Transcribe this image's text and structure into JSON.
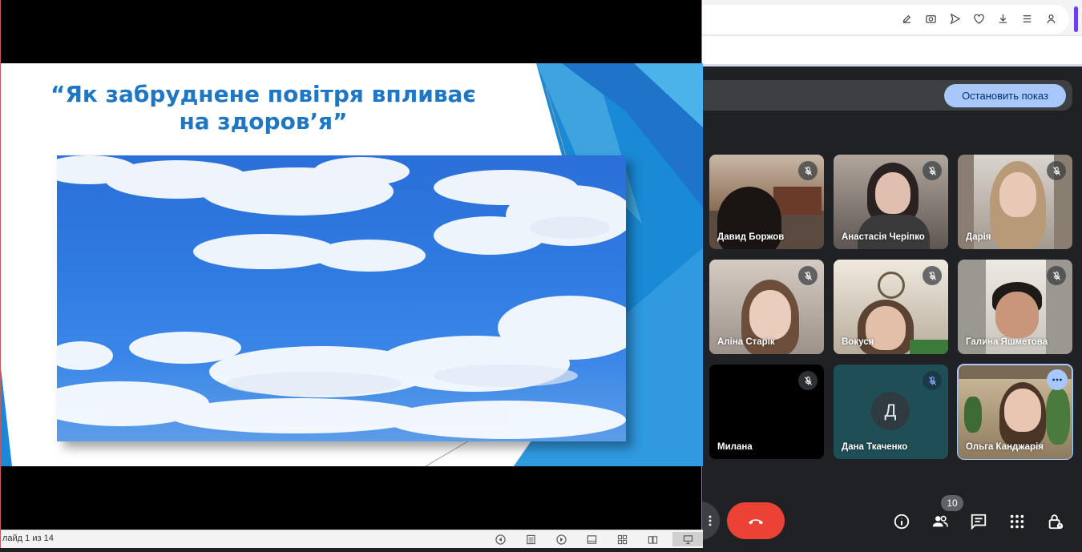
{
  "presentation": {
    "slide_title": "“Як забруднене повітря впливає на здоров’я”",
    "status_text": "лайд 1 из 14"
  },
  "meet": {
    "stop_presenting_label": "Остановить показ",
    "participants": [
      {
        "name": "Давид Боржов"
      },
      {
        "name": "Анастасія Чеpіпко"
      },
      {
        "name": "Дарія"
      },
      {
        "name": "Аліна Старік"
      },
      {
        "name": "Вокуся"
      },
      {
        "name": "Галина Яшметова"
      },
      {
        "name": "Милана"
      },
      {
        "name": "Дана Ткаченко",
        "avatar_letter": "Д"
      },
      {
        "name": "Ольга Канджарія"
      }
    ],
    "people_count": "10",
    "colors": {
      "end_call": "#ea4335",
      "accent": "#a8c7fa"
    }
  }
}
